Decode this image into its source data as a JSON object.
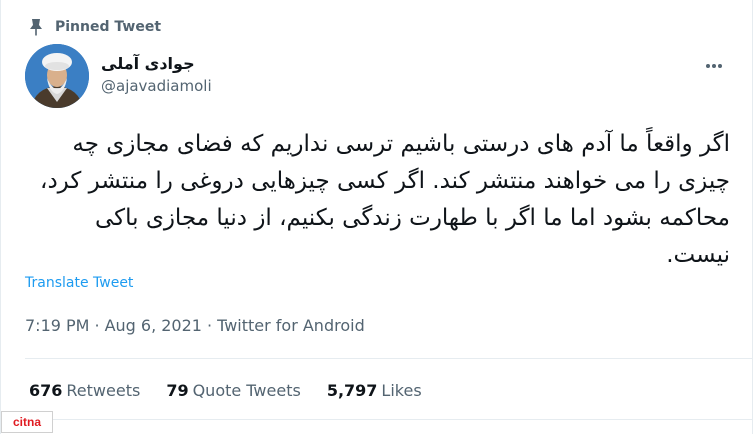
{
  "pinned": {
    "label": "Pinned Tweet",
    "icon": "pin-icon"
  },
  "author": {
    "display_name": "جوادی آملی",
    "handle": "@ajavadiamoli",
    "avatar_icon": "avatar-portrait"
  },
  "more_icon": "more-horizontal-icon",
  "tweet": {
    "text": "اگر واقعاً ما آدم های درستی باشیم ترسی نداریم که فضای مجازی چه چیزی را می خواهند منتشر کند. اگر کسی چیزهایی دروغی را منتشر کرد، محاکمه بشود اما ما اگر با طهارت زندگی بکنیم، از دنیا مجازی باکی نیست.",
    "translate_label": "Translate Tweet"
  },
  "meta": {
    "time": "7:19 PM",
    "sep1": "·",
    "date": "Aug 6, 2021",
    "sep2": "·",
    "source": "Twitter for Android"
  },
  "stats": {
    "retweets_count": "676",
    "retweets_label": "Retweets",
    "quotes_count": "79",
    "quotes_label": "Quote Tweets",
    "likes_count": "5,797",
    "likes_label": "Likes"
  },
  "watermark": {
    "text": "citna"
  },
  "colors": {
    "link": "#1d9bf0",
    "secondary_text": "#536471",
    "primary_text": "#0f1419",
    "divider": "#e6ecf0"
  }
}
